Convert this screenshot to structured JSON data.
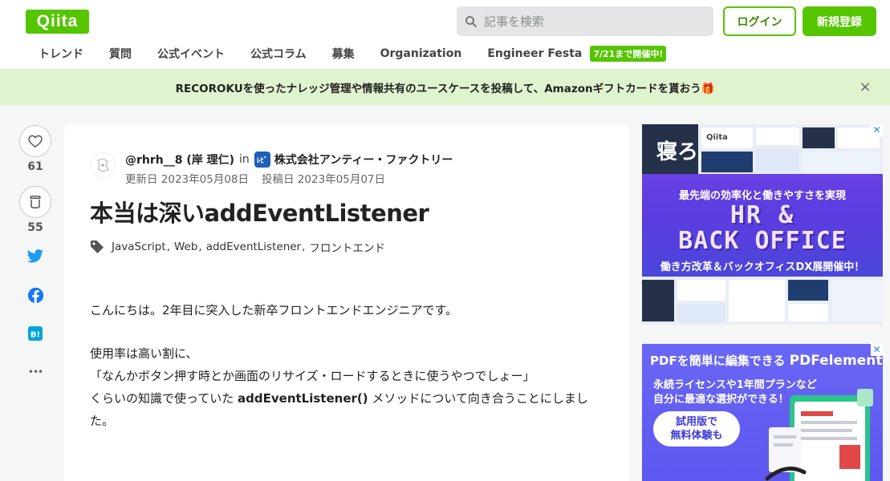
{
  "header": {
    "logo_text": "Qiita",
    "search_placeholder": "記事を検索",
    "login_label": "ログイン",
    "signup_label": "新規登録"
  },
  "nav": {
    "items": [
      "トレンド",
      "質問",
      "公式イベント",
      "公式コラム",
      "募集",
      "Organization",
      "Engineer Festa"
    ],
    "badge": "7/21まで開催中!"
  },
  "banner": {
    "text": "RECOROKUを使ったナレッジ管理や情報共有のユースケースを投稿して、Amazonギフトカードを貰おう🎁",
    "close_glyph": "×"
  },
  "actions": {
    "like_count": "61",
    "stock_count": "55",
    "more_glyph": "•••"
  },
  "article": {
    "author": "@rhrh__8 (岸 理仁)",
    "in_label": "in",
    "org_name": "株式会社アンティー・ファクトリー",
    "org_logo_text": "ﾚﾋﾞ",
    "updated": "更新日 2023年05月08日",
    "posted": "投稿日 2023年05月07日",
    "title": "本当は深いaddEventListener",
    "tags": [
      "JavaScript",
      "Web",
      "addEventListener",
      "フロントエンド"
    ],
    "tag_separator": ",",
    "para1": "こんにちは。2年目に突入した新卒フロントエンドエンジニアです。",
    "para2_line1": "使用率は高い割に、",
    "para2_line2": "「なんかボタン押す時とか画面のリサイズ・ロードするときに使うやつでしょー」",
    "para2_line3_pre": "くらいの知識で使っていた ",
    "para2_line3_code": "addEventListener()",
    "para2_line3_post": " メソッドについて向き合うことにしました。"
  },
  "ads": {
    "ad1": {
      "logo": "Qiita",
      "kanji": "寝ろ。",
      "subtitle": "最先端の効率化と働きやすさを実現",
      "hr": "HR &",
      "bo": "BACK OFFICE",
      "caption": "働き方改革＆バックオフィスDX展開催中！",
      "close_glyph": "✕"
    },
    "ad2": {
      "headline_pre": "PDFを簡単に編集できる ",
      "headline_brand": "PDFelement",
      "line1": "永続ライセンスや1年間プランなど",
      "line2": "自分に最適な選択ができる！",
      "pill_line1": "試用版で",
      "pill_line2": "無料体験も",
      "close_glyph": "✕"
    }
  },
  "colors": {
    "brand": "#55c500",
    "banner_bg": "#dff3cf",
    "twitter": "#1d9bf0",
    "facebook": "#1877f2",
    "hatena": "#00a4de"
  }
}
